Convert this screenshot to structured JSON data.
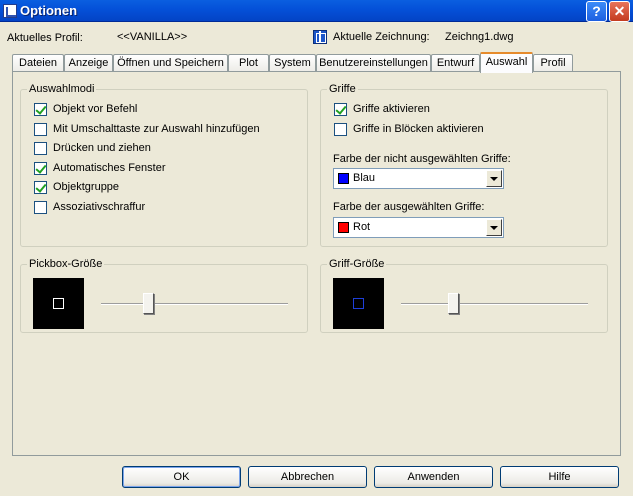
{
  "window": {
    "title": "Optionen",
    "help_label": "?",
    "close_label": "✕"
  },
  "header": {
    "profile_label": "Aktuelles Profil:",
    "profile_value": "<<VANILLA>>",
    "drawing_label": "Aktuelle Zeichnung:",
    "drawing_value": "Zeichng1.dwg"
  },
  "tabs": [
    {
      "label": "Dateien"
    },
    {
      "label": "Anzeige"
    },
    {
      "label": "Öffnen und Speichern"
    },
    {
      "label": "Plot"
    },
    {
      "label": "System"
    },
    {
      "label": "Benutzereinstellungen"
    },
    {
      "label": "Entwurf"
    },
    {
      "label": "Auswahl"
    },
    {
      "label": "Profil"
    }
  ],
  "active_tab": "Auswahl",
  "selection_modes": {
    "title": "Auswahlmodi",
    "items": [
      {
        "label": "Objekt vor Befehl",
        "checked": true
      },
      {
        "label": "Mit Umschalttaste zur Auswahl hinzufügen",
        "checked": false
      },
      {
        "label": "Drücken und ziehen",
        "checked": false
      },
      {
        "label": "Automatisches Fenster",
        "checked": true
      },
      {
        "label": "Objektgruppe",
        "checked": true
      },
      {
        "label": "Assoziativschraffur",
        "checked": false
      }
    ]
  },
  "grips": {
    "title": "Griffe",
    "items": [
      {
        "label": "Griffe aktivieren",
        "checked": true
      },
      {
        "label": "Griffe in Blöcken aktivieren",
        "checked": false
      }
    ],
    "unselected_color_label": "Farbe der nicht ausgewählten Griffe:",
    "unselected_color_value": "Blau",
    "unselected_color_hex": "#0000FF",
    "selected_color_label": "Farbe der ausgewählten Griffe:",
    "selected_color_value": "Rot",
    "selected_color_hex": "#FF0000"
  },
  "pickbox": {
    "title": "Pickbox-Größe",
    "level": 0.25
  },
  "grip_size": {
    "title": "Griff-Größe",
    "level": 0.28
  },
  "buttons": {
    "ok": "OK",
    "cancel": "Abbrechen",
    "apply": "Anwenden",
    "help": "Hilfe"
  }
}
